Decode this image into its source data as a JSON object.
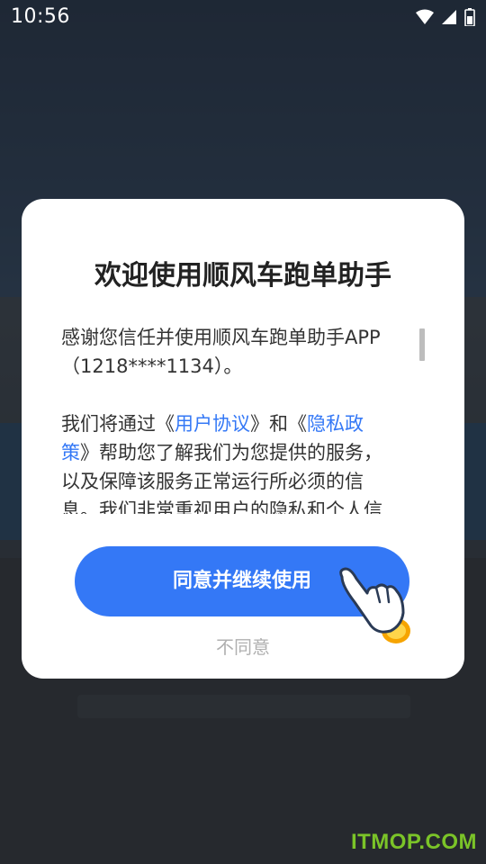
{
  "status_bar": {
    "time": "10:56"
  },
  "dialog": {
    "title": "欢迎使用顺风车跑单助手",
    "para1_line1": "感谢您信任并使用顺风车跑单助手APP",
    "para1_line2": "（1218****1134）。",
    "para2_prefix": "我们将通过《",
    "link_user_agreement": "用户协议",
    "para2_mid": "》和《",
    "link_privacy_part1": "隐私政",
    "link_privacy_part2": "策",
    "para2_suffix_line": "》帮助您了解我们为您提供的服务，",
    "para2_line3": "以及保障该服务正常运行所必须的信",
    "para2_line4": "息。我们非常重视用户的隐私和个人信",
    "agree_label": "同意并继续使用",
    "disagree_label": "不同意"
  },
  "watermark": "ITMOP.COM",
  "colors": {
    "accent": "#3478f6",
    "watermark": "#7bc428"
  }
}
